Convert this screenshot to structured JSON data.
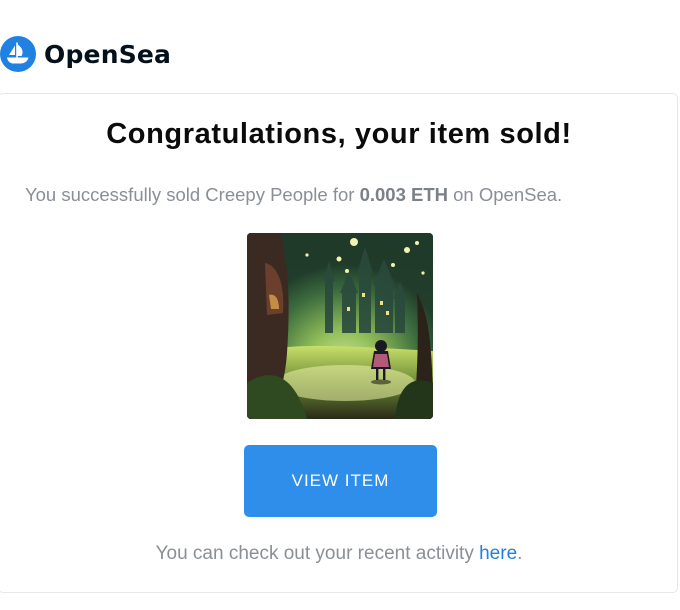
{
  "brand": {
    "name": "OpenSea",
    "logo_icon": "opensea-boat-icon",
    "logo_color": "#2081E2"
  },
  "email": {
    "headline": "Congratulations, your item sold!",
    "sold": {
      "prefix": "You successfully sold Creepy People for ",
      "price": "0.003 ETH",
      "suffix": " on OpenSea."
    },
    "artwork_icon": "nft-artwork-image",
    "cta_label": "VIEW ITEM",
    "cta_color": "#2F8EE9",
    "footer": {
      "prefix": "You can check out your recent activity ",
      "link": "here",
      "suffix": "."
    }
  }
}
